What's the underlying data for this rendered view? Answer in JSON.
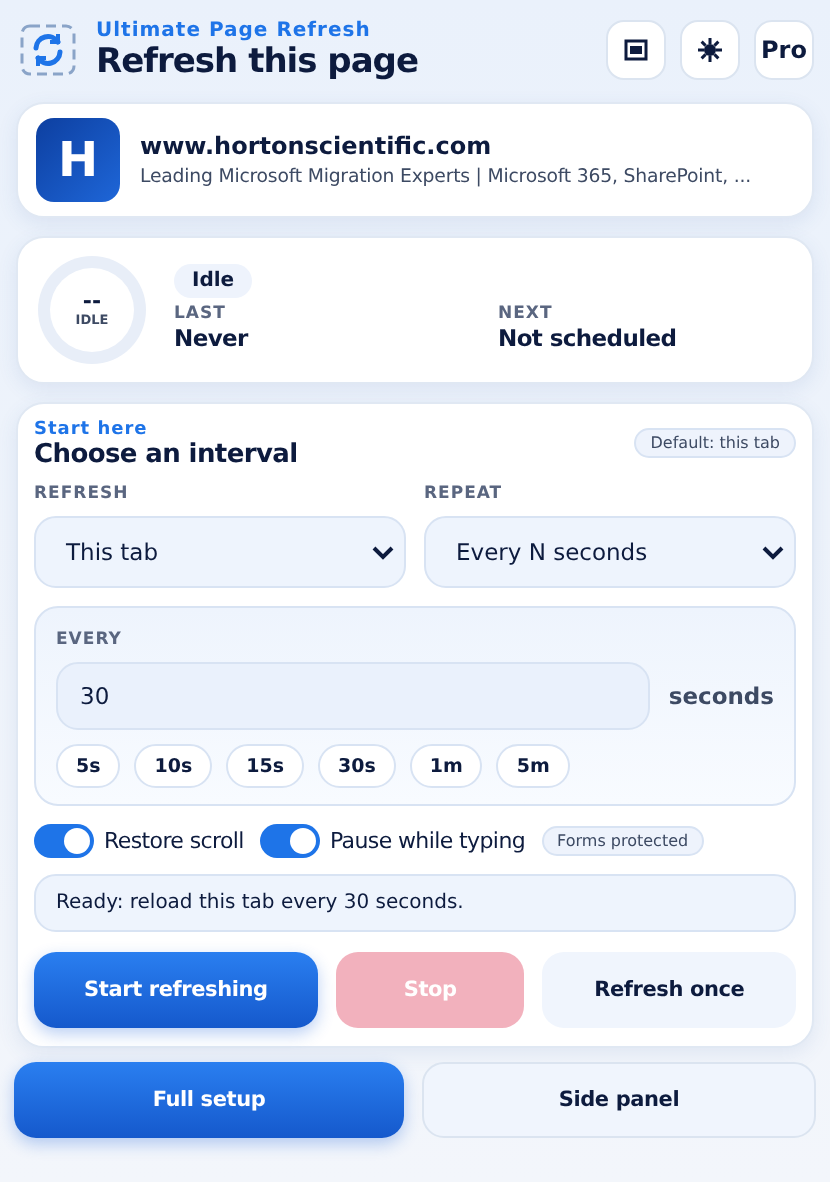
{
  "header": {
    "brand": "Ultimate Page Refresh",
    "title": "Refresh this page",
    "actions": [
      {
        "kind": "window"
      },
      {
        "kind": "theme"
      },
      {
        "kind": "text",
        "label": "Pro"
      }
    ]
  },
  "site": {
    "initial": "H",
    "domain": "www.hortonscientific.com",
    "description": "Leading Microsoft Migration Experts | Microsoft 365, SharePoint, ..."
  },
  "status": {
    "ring_value": "--",
    "ring_label": "IDLE",
    "badge": "Idle",
    "last_label": "LAST",
    "last_value": "Never",
    "next_label": "NEXT",
    "next_value": "Not scheduled"
  },
  "interval": {
    "eyebrow": "Start here",
    "title": "Choose an interval",
    "default_badge": "Default: this tab",
    "refresh": {
      "label": "REFRESH",
      "value": "This tab"
    },
    "repeat": {
      "label": "REPEAT",
      "value": "Every N seconds"
    },
    "every": {
      "label": "EVERY",
      "value": "30",
      "unit": "seconds"
    },
    "presets": [
      {
        "label": "5s",
        "selected": false
      },
      {
        "label": "10s",
        "selected": false
      },
      {
        "label": "15s",
        "selected": false
      },
      {
        "label": "30s",
        "selected": false
      },
      {
        "label": "1m",
        "selected": false
      },
      {
        "label": "5m",
        "selected": false
      }
    ],
    "toggles": [
      {
        "label": "Restore scroll",
        "on": true
      },
      {
        "label": "Pause while typing",
        "on": true
      }
    ],
    "forms_badge": "Forms protected",
    "message": "Ready: reload this tab every 30 seconds.",
    "buttons": [
      {
        "label": "Start refreshing",
        "kind": "primary",
        "disabled": false
      },
      {
        "label": "Stop",
        "kind": "danger",
        "disabled": true
      },
      {
        "label": "Refresh once",
        "kind": "secondary",
        "disabled": false
      }
    ]
  },
  "footer_buttons": [
    {
      "label": "Full setup",
      "kind": "primary"
    },
    {
      "label": "Side panel",
      "kind": "secondary"
    }
  ]
}
